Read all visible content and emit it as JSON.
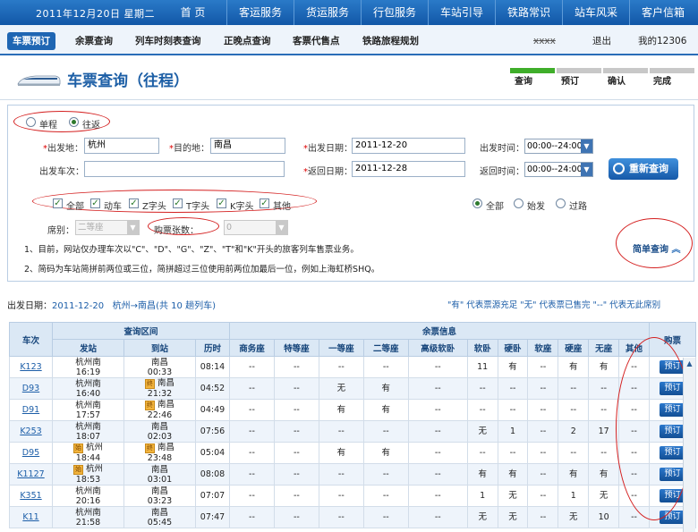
{
  "topbar": {
    "date": "2011年12月20日 星期二",
    "nav": [
      "首  页",
      "客运服务",
      "货运服务",
      "行包服务",
      "车站引导",
      "铁路常识",
      "站车风采",
      "客户信箱"
    ]
  },
  "subnav": {
    "tabs": [
      "车票预订",
      "余票查询",
      "列车时刻表查询",
      "正晚点查询",
      "客票代售点",
      "铁路旅程规划"
    ],
    "user": "xxxx",
    "logout": "退出",
    "my": "我的12306"
  },
  "page": {
    "title": "车票查询（往程）",
    "steps": [
      "查询",
      "预订",
      "确认",
      "完成"
    ]
  },
  "trip": {
    "oneway": "单程",
    "roundtrip": "往返"
  },
  "form": {
    "from_label": "出发地：",
    "from": "杭州",
    "to_label": "目的地：",
    "to": "南昌",
    "depart_date_label": "出发日期：",
    "depart_date": "2011-12-20",
    "depart_time_label": "出发时间：",
    "depart_time": "00:00--24:00",
    "train_label": "出发车次：",
    "train": "",
    "return_date_label": "返回日期：",
    "return_date": "2011-12-28",
    "return_time_label": "返回时间：",
    "return_time": "00:00--24:00",
    "requery": "重新查询"
  },
  "types": [
    "全部",
    "动车",
    "Z字头",
    "T字头",
    "K字头",
    "其他"
  ],
  "stationfilter": [
    "全部",
    "始发",
    "过路"
  ],
  "seat": {
    "label": "席别：",
    "value": "二等座",
    "count_label": "购票张数：",
    "count": "0"
  },
  "notes": [
    "1、目前，网站仅办理车次以\"C\"、\"D\"、\"G\"、\"Z\"、\"T\"和\"K\"开头的旅客列车售票业务。",
    "2、简码为车站简拼前两位或三位，简拼超过三位使用前两位加最后一位，例如上海虹桥SHQ。"
  ],
  "simple": "简单查询",
  "result": {
    "date_label": "出发日期：",
    "date": "2011-12-20",
    "route": "杭州→南昌",
    "count_pre": "(共",
    "count": "10",
    "count_suf": "趟列车)",
    "legend": "\"有\" 代表票源充足  \"无\" 代表票已售完  \"--\" 代表无此席别"
  },
  "table": {
    "h_train": "车次",
    "h_interval": "查询区间",
    "h_left": "余票信息",
    "h_book": "购票",
    "h_from": "发站",
    "h_to": "到站",
    "h_dur": "历时",
    "seats": [
      "商务座",
      "特等座",
      "一等座",
      "二等座",
      "高级软卧",
      "软卧",
      "硬卧",
      "软座",
      "硬座",
      "无座",
      "其他"
    ],
    "book_label": "预订",
    "rows": [
      {
        "no": "K123",
        "from": "杭州南",
        "ft": "16:19",
        "ftag": "",
        "to": "南昌",
        "tt": "00:33",
        "ttag": "",
        "dur": "08:14",
        "s": [
          "--",
          "--",
          "--",
          "--",
          "--",
          "11",
          "有",
          "--",
          "有",
          "有",
          "--"
        ]
      },
      {
        "no": "D93",
        "from": "杭州南",
        "ft": "16:40",
        "ftag": "",
        "to": "南昌",
        "tt": "21:32",
        "ttag": "终",
        "dur": "04:52",
        "s": [
          "--",
          "--",
          "无",
          "有",
          "--",
          "--",
          "--",
          "--",
          "--",
          "--",
          "--"
        ]
      },
      {
        "no": "D91",
        "from": "杭州南",
        "ft": "17:57",
        "ftag": "",
        "to": "南昌",
        "tt": "22:46",
        "ttag": "终",
        "dur": "04:49",
        "s": [
          "--",
          "--",
          "有",
          "有",
          "--",
          "--",
          "--",
          "--",
          "--",
          "--",
          "--"
        ]
      },
      {
        "no": "K253",
        "from": "杭州南",
        "ft": "18:07",
        "ftag": "",
        "to": "南昌",
        "tt": "02:03",
        "ttag": "",
        "dur": "07:56",
        "s": [
          "--",
          "--",
          "--",
          "--",
          "--",
          "无",
          "1",
          "--",
          "2",
          "17",
          "--"
        ]
      },
      {
        "no": "D95",
        "from": "杭州",
        "ft": "18:44",
        "ftag": "始",
        "to": "南昌",
        "tt": "23:48",
        "ttag": "终",
        "dur": "05:04",
        "s": [
          "--",
          "--",
          "有",
          "有",
          "--",
          "--",
          "--",
          "--",
          "--",
          "--",
          "--"
        ]
      },
      {
        "no": "K1127",
        "from": "杭州",
        "ft": "18:53",
        "ftag": "始",
        "to": "南昌",
        "tt": "03:01",
        "ttag": "",
        "dur": "08:08",
        "s": [
          "--",
          "--",
          "--",
          "--",
          "--",
          "有",
          "有",
          "--",
          "有",
          "有",
          "--"
        ]
      },
      {
        "no": "K351",
        "from": "杭州南",
        "ft": "20:16",
        "ftag": "",
        "to": "南昌",
        "tt": "03:23",
        "ttag": "",
        "dur": "07:07",
        "s": [
          "--",
          "--",
          "--",
          "--",
          "--",
          "1",
          "无",
          "--",
          "1",
          "无",
          "--"
        ]
      },
      {
        "no": "K11",
        "from": "杭州南",
        "ft": "21:58",
        "ftag": "",
        "to": "南昌",
        "tt": "05:45",
        "ttag": "",
        "dur": "07:47",
        "s": [
          "--",
          "--",
          "--",
          "--",
          "--",
          "无",
          "无",
          "--",
          "无",
          "10",
          "--"
        ]
      }
    ]
  }
}
